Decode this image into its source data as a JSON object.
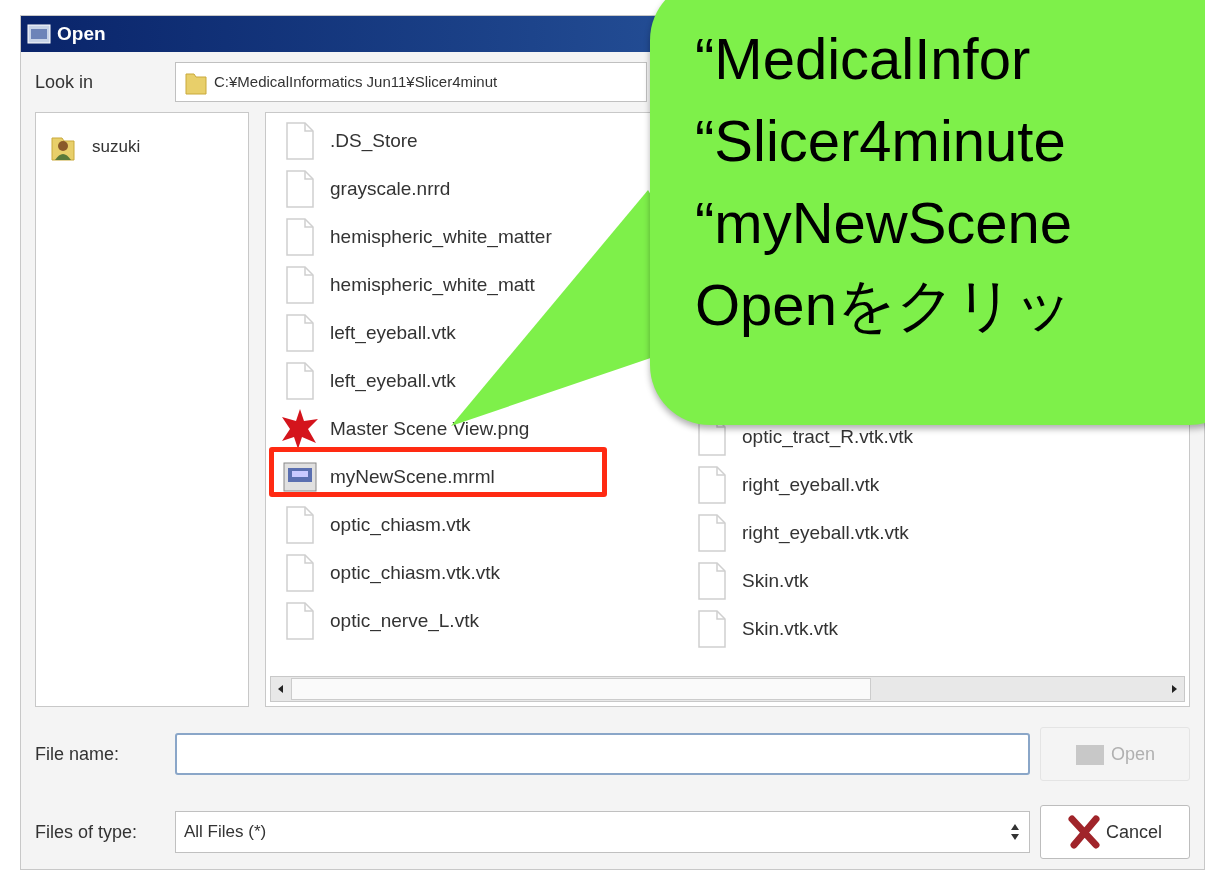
{
  "window": {
    "title": "Open"
  },
  "look_in": {
    "label": "Look in",
    "path": "C:¥MedicalInformatics Jun11¥Slicer4minut"
  },
  "sidebar": {
    "items": [
      {
        "label": "suzuki",
        "selected": false
      }
    ]
  },
  "files": {
    "columns": [
      {
        "items": [
          {
            "name": ".DS_Store",
            "kind": "file",
            "highlighted": false
          },
          {
            "name": "grayscale.nrrd",
            "kind": "file",
            "highlighted": false
          },
          {
            "name": "hemispheric_white_matter",
            "kind": "file",
            "highlighted": false
          },
          {
            "name": "hemispheric_white_matt",
            "kind": "file",
            "highlighted": false
          },
          {
            "name": "left_eyeball.vtk",
            "kind": "file",
            "highlighted": false
          },
          {
            "name": "left_eyeball.vtk",
            "kind": "file",
            "highlighted": false
          },
          {
            "name": "Master Scene View.png",
            "kind": "image",
            "highlighted": false
          },
          {
            "name": "myNewScene.mrml",
            "kind": "scene",
            "highlighted": true
          },
          {
            "name": "optic_chiasm.vtk",
            "kind": "file",
            "highlighted": false
          },
          {
            "name": "optic_chiasm.vtk.vtk",
            "kind": "file",
            "highlighted": false
          },
          {
            "name": "optic_nerve_L.vtk",
            "kind": "file",
            "highlighted": false
          }
        ]
      },
      {
        "items": [
          {
            "name": "optic_tract_R.vtk.vtk",
            "kind": "file",
            "highlighted": false
          },
          {
            "name": "right_eyeball.vtk",
            "kind": "file",
            "highlighted": false
          },
          {
            "name": "right_eyeball.vtk.vtk",
            "kind": "file",
            "highlighted": false
          },
          {
            "name": "Skin.vtk",
            "kind": "file",
            "highlighted": false
          },
          {
            "name": "Skin.vtk.vtk",
            "kind": "file",
            "highlighted": false
          }
        ]
      }
    ]
  },
  "file_name": {
    "label": "File name:"
  },
  "file_type": {
    "label": "Files of type:",
    "value": "All Files (*)"
  },
  "buttons": [
    {
      "label": "Open",
      "kind": "open",
      "disabled": true
    },
    {
      "label": "Cancel",
      "kind": "cancel",
      "disabled": false
    }
  ],
  "callout": {
    "lines": [
      "“MedicalInfor",
      "“Slicer4minute",
      "“myNewScene",
      "Openをクリッ"
    ]
  }
}
